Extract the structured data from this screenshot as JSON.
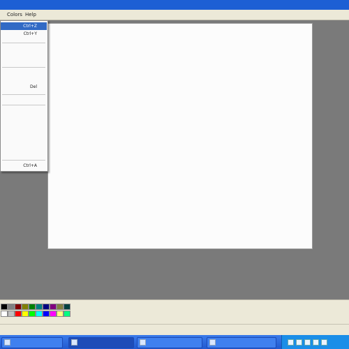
{
  "menubar": {
    "items": [
      "",
      "Colors",
      "Help"
    ]
  },
  "dropdown": {
    "items": [
      {
        "label": "",
        "shortcut": "Ctrl+Z",
        "state": "highlighted"
      },
      {
        "label": "",
        "shortcut": "Ctrl+Y",
        "state": "normal"
      },
      {
        "label": "",
        "shortcut": "",
        "state": "disabled"
      },
      {
        "label": "",
        "shortcut": "Del",
        "state": "normal"
      },
      {
        "label": "",
        "shortcut": "",
        "state": "disabled"
      },
      {
        "label": "",
        "shortcut": "",
        "state": "disabled"
      },
      {
        "label": "",
        "shortcut": "Ctrl+A",
        "state": "normal"
      }
    ]
  },
  "palette": {
    "colors": [
      "#000000",
      "#808080",
      "#800000",
      "#808000",
      "#008000",
      "#008080",
      "#000080",
      "#800080",
      "#808040",
      "#004040",
      "#ffffff",
      "#c0c0c0",
      "#ff0000",
      "#ffff00",
      "#00ff00",
      "#00ffff",
      "#0000ff",
      "#ff00ff",
      "#ffff80",
      "#00ff80"
    ]
  },
  "taskbar": {
    "start_label": "",
    "buttons": [
      {
        "label": "",
        "active": false
      },
      {
        "label": "",
        "active": true
      },
      {
        "label": "",
        "active": false
      },
      {
        "label": "",
        "active": false
      }
    ],
    "clock": ""
  },
  "colors": {
    "title_blue": "#1d5fd4",
    "highlight": "#316ac5",
    "workspace": "#7a7a7a"
  }
}
